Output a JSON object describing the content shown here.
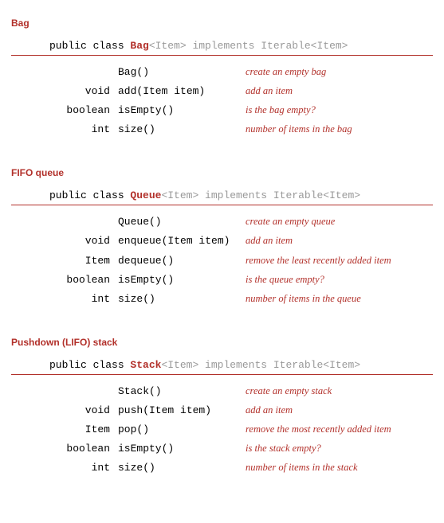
{
  "sections": [
    {
      "title": "Bag",
      "decl": {
        "prefix": "public class ",
        "name": "Bag",
        "generic": "<Item>",
        "impl": " implements Iterable<Item>"
      },
      "methods": [
        {
          "ret": "",
          "sig": "Bag()",
          "desc": "create an empty bag"
        },
        {
          "ret": "void",
          "sig": "add(Item item)",
          "desc": "add an item"
        },
        {
          "ret": "boolean",
          "sig": "isEmpty()",
          "desc": "is the bag empty?"
        },
        {
          "ret": "int",
          "sig": "size()",
          "desc": "number of items in the bag"
        }
      ]
    },
    {
      "title": "FIFO queue",
      "decl": {
        "prefix": "public class ",
        "name": "Queue",
        "generic": "<Item>",
        "impl": " implements Iterable<Item>"
      },
      "methods": [
        {
          "ret": "",
          "sig": "Queue()",
          "desc": "create an empty queue"
        },
        {
          "ret": "void",
          "sig": "enqueue(Item item)",
          "desc": "add an item"
        },
        {
          "ret": "Item",
          "sig": "dequeue()",
          "desc": "remove the least recently added item"
        },
        {
          "ret": "boolean",
          "sig": "isEmpty()",
          "desc": "is the queue empty?"
        },
        {
          "ret": "int",
          "sig": "size()",
          "desc": "number of items in the queue"
        }
      ]
    },
    {
      "title": "Pushdown (LIFO) stack",
      "decl": {
        "prefix": "public class ",
        "name": "Stack",
        "generic": "<Item>",
        "impl": " implements Iterable<Item>"
      },
      "methods": [
        {
          "ret": "",
          "sig": "Stack()",
          "desc": "create an empty stack"
        },
        {
          "ret": "void",
          "sig": "push(Item item)",
          "desc": "add an item"
        },
        {
          "ret": "Item",
          "sig": "pop()",
          "desc": "remove the most recently added item"
        },
        {
          "ret": "boolean",
          "sig": "isEmpty()",
          "desc": "is the stack empty?"
        },
        {
          "ret": "int",
          "sig": "size()",
          "desc": "number of items in the stack"
        }
      ]
    }
  ]
}
